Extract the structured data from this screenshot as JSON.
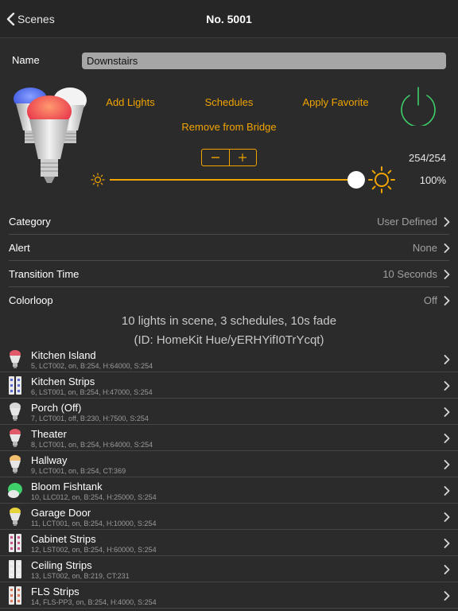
{
  "navbar": {
    "back_label": "Scenes",
    "title": "No. 5001"
  },
  "name": {
    "label": "Name",
    "value": "Downstairs"
  },
  "actions": {
    "add_lights": "Add Lights",
    "schedules": "Schedules",
    "apply_favorite": "Apply Favorite",
    "remove_from_bridge": "Remove from Bridge"
  },
  "brightness": {
    "value_text": "254/254",
    "percent_text": "100%",
    "level": 1.0
  },
  "settings": [
    {
      "label": "Category",
      "value": "User Defined"
    },
    {
      "label": "Alert",
      "value": "None"
    },
    {
      "label": "Transition Time",
      "value": "10 Seconds"
    },
    {
      "label": "Colorloop",
      "value": "Off"
    }
  ],
  "summary": {
    "line1": "10 lights in scene, 3 schedules, 10s fade",
    "line2": "(ID: HomeKit Hue/yERHYifI0TrYcqt)"
  },
  "lights": [
    {
      "name": "Kitchen Island",
      "detail": "5, LCT002, on, B:254, H:64000, S:254",
      "icon": "bulb-icon",
      "color": "#e05a6a"
    },
    {
      "name": "Kitchen Strips",
      "detail": "6, LST001, on, B:254, H:47000, S:254",
      "icon": "lightstrip-icon",
      "color": "#5b6bd8"
    },
    {
      "name": "Porch (Off)",
      "detail": "7, LCT001, off, B:230, H:7500, S:254",
      "icon": "bulb-icon",
      "color": "#d8d8d8"
    },
    {
      "name": "Theater",
      "detail": "8, LCT001, on, B:254, H:64000, S:254",
      "icon": "bulb-icon",
      "color": "#e05a6a"
    },
    {
      "name": "Hallway",
      "detail": "9, LCT001, on, B:254, CT:369",
      "icon": "bulb-icon",
      "color": "#f3c070"
    },
    {
      "name": "Bloom Fishtank",
      "detail": "10, LLC012, on, B:254, H:25000, S:254",
      "icon": "bloom-icon",
      "color": "#3ecf6a"
    },
    {
      "name": "Garage Door",
      "detail": "11, LCT001, on, B:254, H:10000, S:254",
      "icon": "bulb-icon",
      "color": "#e6d23a"
    },
    {
      "name": "Cabinet Strips",
      "detail": "12, LST002, on, B:254, H:60000, S:254",
      "icon": "lightstrip-icon",
      "color": "#d0508a"
    },
    {
      "name": "Ceiling Strips",
      "detail": "13, LST002, on, B:219, CT:231",
      "icon": "lightstrip-icon",
      "color": "#f2f2f2"
    },
    {
      "name": "FLS Strips",
      "detail": "14, FLS-PP3, on, B:254, H:4000, S:254",
      "icon": "lightstrip-icon",
      "color": "#e07a5a"
    }
  ],
  "colors": {
    "accent": "#f0a400",
    "power": "#3ecf6a",
    "background": "#2b2b2b"
  }
}
